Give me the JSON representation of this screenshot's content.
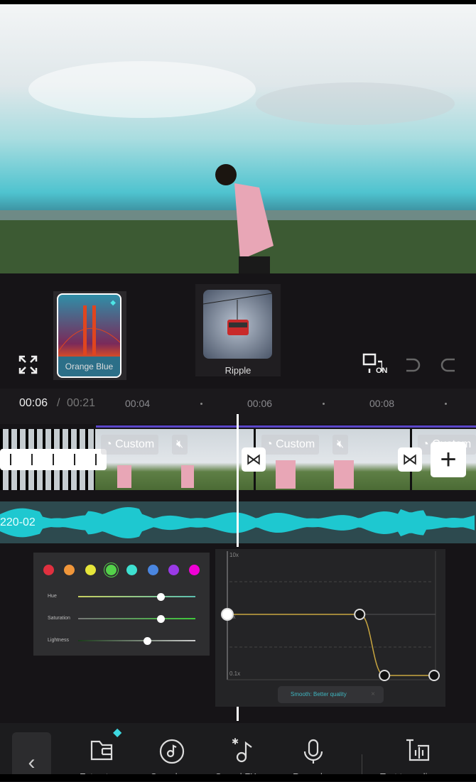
{
  "filters": [
    {
      "label": "Orange Blue",
      "selected": true,
      "premium": true
    },
    {
      "label": "Ripple",
      "selected": false
    }
  ],
  "toolbar": {
    "fullscreen_icon": "expand-icon",
    "keyframe_toggle": "ON",
    "undo_icon": "undo-icon",
    "redo_icon": "redo-icon"
  },
  "timeline": {
    "current": "00:06",
    "separator": "/",
    "total": "00:21",
    "ticks": [
      "00:04",
      "00:06",
      "00:08"
    ]
  },
  "clips": [
    {
      "speed_label": "Custom",
      "muted": true
    },
    {
      "speed_label": "Custom",
      "muted": true
    },
    {
      "speed_label": "Custom",
      "muted": true
    }
  ],
  "audio": {
    "label": "220-02",
    "color": "#1ec8d0"
  },
  "hsl": {
    "swatches": [
      "#e0303f",
      "#f0963a",
      "#e6e63a",
      "#54d24a",
      "#3ee0d0",
      "#4a86e0",
      "#9a3ae6",
      "#f000d6"
    ],
    "selected_index": 3,
    "sliders": [
      {
        "label": "Hue",
        "value": 0.7
      },
      {
        "label": "Saturation",
        "value": 0.7
      },
      {
        "label": "Lightness",
        "value": 0.59
      }
    ]
  },
  "speed_curve": {
    "y_max": "10x",
    "y_mid": "1x",
    "y_min": "0.1x",
    "points": [
      [
        0,
        1
      ],
      [
        0.64,
        1
      ],
      [
        0.76,
        0.1
      ],
      [
        1,
        0.1
      ]
    ],
    "line_color": "#c9a640",
    "toast": "Smooth: Better quality",
    "toast_close": "×"
  },
  "bottom_tools": [
    {
      "label": "Extract",
      "icon": "folder-icon",
      "premium": true
    },
    {
      "label": "Sounds",
      "icon": "music-disc-icon"
    },
    {
      "label": "Sound FX",
      "icon": "sound-fx-icon"
    },
    {
      "label": "Record",
      "icon": "microphone-icon"
    },
    {
      "label": "Text to audio",
      "icon": "text-to-audio-icon"
    }
  ]
}
